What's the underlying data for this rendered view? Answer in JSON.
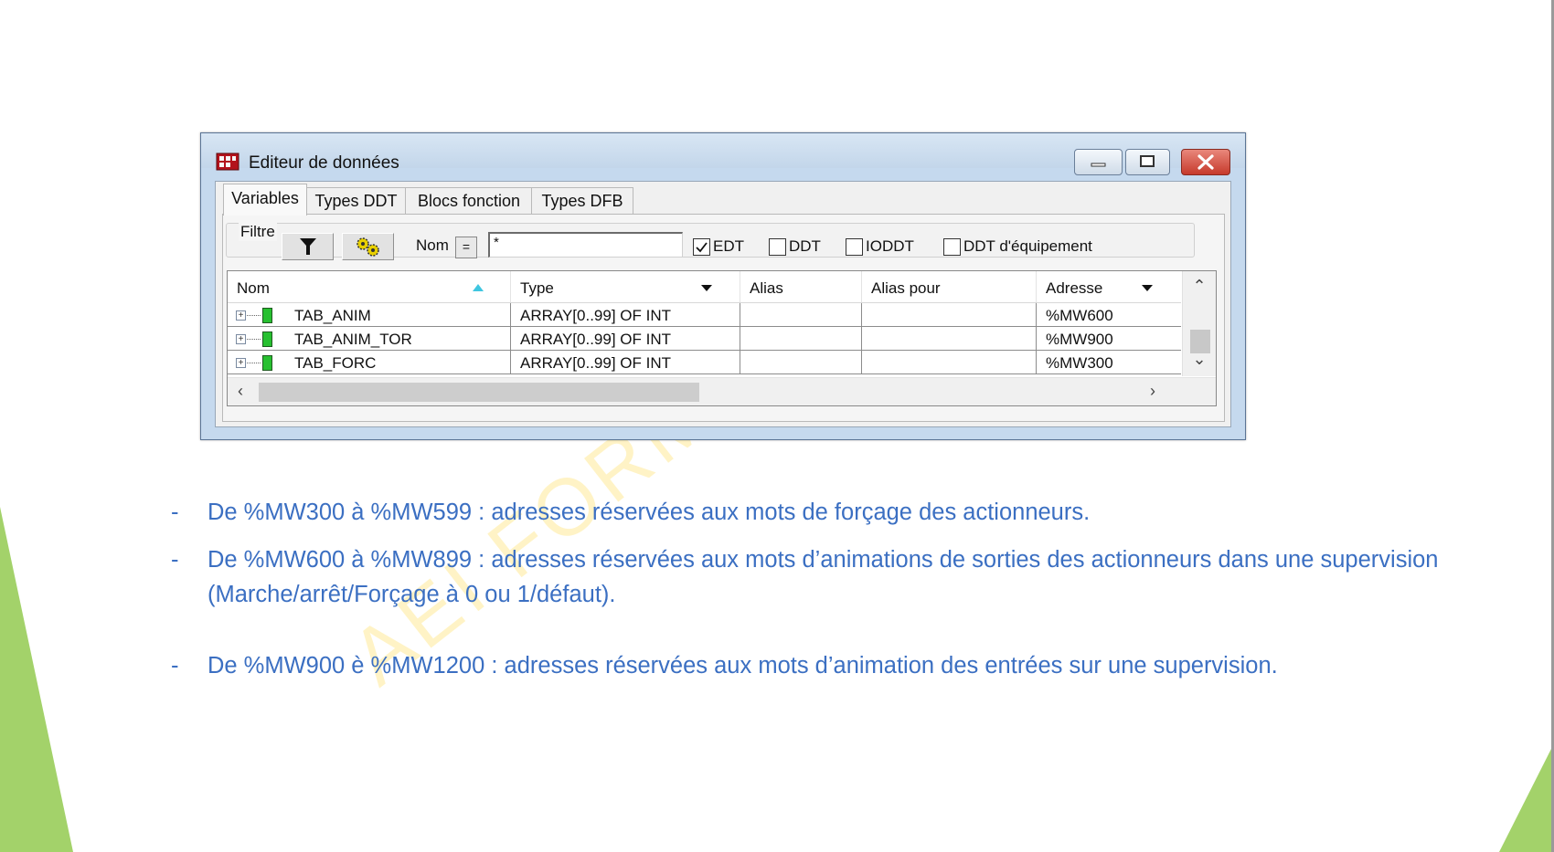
{
  "window": {
    "title": "Editeur de données"
  },
  "tabs": [
    {
      "label": "Variables",
      "active": true
    },
    {
      "label": "Types DDT",
      "active": false
    },
    {
      "label": "Blocs fonction",
      "active": false
    },
    {
      "label": "Types DFB",
      "active": false
    }
  ],
  "filter": {
    "group_label": "Filtre",
    "nom_label": "Nom",
    "operator": "=",
    "value": "*",
    "checkboxes": [
      {
        "label": "EDT",
        "checked": true
      },
      {
        "label": "DDT",
        "checked": false
      },
      {
        "label": "IODDT",
        "checked": false
      },
      {
        "label": "DDT d'équipement",
        "checked": false
      }
    ]
  },
  "grid": {
    "columns": [
      "Nom",
      "Type",
      "Alias",
      "Alias pour",
      "Adresse"
    ],
    "rows": [
      {
        "name": "TAB_ANIM",
        "type": "ARRAY[0..99] OF INT",
        "alias": "",
        "alias_for": "",
        "address": "%MW600"
      },
      {
        "name": "TAB_ANIM_TOR",
        "type": "ARRAY[0..99] OF INT",
        "alias": "",
        "alias_for": "",
        "address": "%MW900"
      },
      {
        "name": "TAB_FORC",
        "type": "ARRAY[0..99] OF INT",
        "alias": "",
        "alias_for": "",
        "address": "%MW300"
      }
    ]
  },
  "bullets": [
    {
      "dash": "-",
      "text": "De %MW300 à %MW599 : adresses réservées aux mots de forçage des actionneurs."
    },
    {
      "dash": "-",
      "text": "De %MW600 à %MW899 : adresses réservées aux mots d’animations de sorties des actionneurs dans une supervision (Marche/arrêt/Forçage à 0 ou 1/défaut)."
    },
    {
      "dash": "-",
      "text": "De %MW900 è %MW1200 : adresses réservées aux mots d’animation des entrées sur une supervision."
    }
  ],
  "watermark": "AEI FORMA",
  "colors": {
    "bullet_text": "#3b6fc2",
    "accent_green": "#a3d26a",
    "title_bar": "#c8dbef",
    "variable_icon": "#27c030",
    "watermark": "#fff0b4"
  }
}
